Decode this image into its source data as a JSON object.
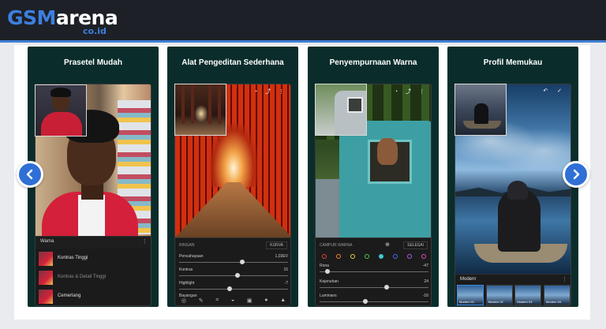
{
  "header": {
    "logo_main": "GSM",
    "logo_accent": "arena",
    "logo_suffix": "co.id"
  },
  "carousel": {
    "slides": [
      {
        "caption": "Prasetel Mudah",
        "panel_label": "Warna",
        "presets": [
          "Kontras Tinggi",
          "Kontras & Detail Tinggi",
          "Cemerlang"
        ]
      },
      {
        "caption": "Alat Pengeditan Sederhana",
        "section_label": "RINGAN",
        "button_label": "KURVA",
        "sliders": [
          {
            "label": "Pencahayaan",
            "value": "1,03EV",
            "level": 0.58
          },
          {
            "label": "Kontras",
            "value": "15",
            "level": 0.54
          },
          {
            "label": "Highlight",
            "value": "-7",
            "level": 0.46
          },
          {
            "label": "Bayangan",
            "value": "",
            "level": 0.5
          }
        ]
      },
      {
        "caption": "Penyempurnaan Warna",
        "section_label": "CAMPUR WARNA",
        "button_label": "SELESAI",
        "swatch_colors": [
          "#e0453a",
          "#ef8a2a",
          "#e5d03c",
          "#55c24e",
          "#3ec7c9",
          "#3a73e6",
          "#a75ae8",
          "#e052b1"
        ],
        "selected_swatch": 4,
        "sliders": [
          {
            "label": "Rona",
            "value": "-47",
            "level": 0.05
          },
          {
            "label": "Kejenuhan",
            "value": "24",
            "level": 0.62
          },
          {
            "label": "Luminans",
            "value": "-16",
            "level": 0.42
          }
        ]
      },
      {
        "caption": "Profil Memukau",
        "panel_label": "Modern",
        "thumbs": [
          "Modern 01",
          "Modern 02",
          "Modern 03",
          "Modern 04"
        ]
      }
    ]
  },
  "colors": {
    "header_bg": "#1d2026",
    "brand_blue": "#3d7fe0",
    "card_bg": "#0a2d2b",
    "nav_button": "#2f6fd6"
  }
}
